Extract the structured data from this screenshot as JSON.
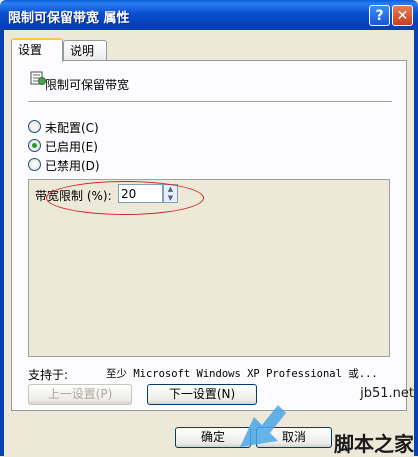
{
  "window": {
    "title": "限制可保留带宽 属性",
    "help_label": "?",
    "close_label": "✕"
  },
  "tabs": [
    {
      "label": "设置",
      "active": true
    },
    {
      "label": "说明",
      "active": false
    }
  ],
  "policy": {
    "icon": "policy-setting-icon",
    "title": "限制可保留带宽"
  },
  "options": [
    {
      "label": "未配置(C)",
      "checked": false
    },
    {
      "label": "已启用(E)",
      "checked": true
    },
    {
      "label": "已禁用(D)",
      "checked": false
    }
  ],
  "bandwidth": {
    "label": "带宽限制 (%):",
    "value": "20"
  },
  "supported": {
    "label": "支持于:",
    "value": "至少 Microsoft Windows XP Professional 或..."
  },
  "buttons": {
    "prev": "上一设置(P)",
    "next": "下一设置(N)",
    "ok": "确定",
    "cancel": "取消"
  },
  "watermark": {
    "site": "jb51.net",
    "name": "脚本之家"
  },
  "colors": {
    "titlebar": "#0a50d0",
    "annotation": "#d62222"
  }
}
